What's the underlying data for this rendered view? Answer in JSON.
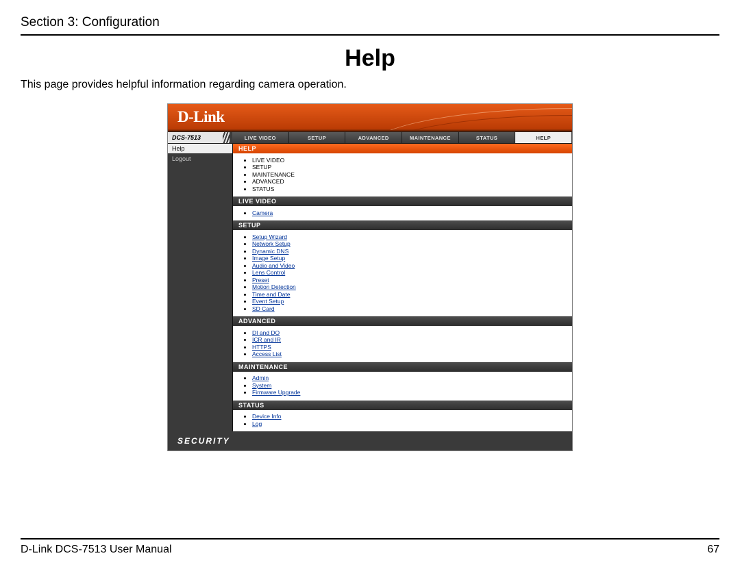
{
  "doc": {
    "section_header": "Section 3: Configuration",
    "page_title": "Help",
    "intro": "This page provides helpful information regarding camera operation.",
    "footer_left": "D-Link DCS-7513 User Manual",
    "footer_right": "67"
  },
  "ui": {
    "brand": "D-Link",
    "model": "DCS-7513",
    "tabs": {
      "live": "LIVE VIDEO",
      "setup": "SETUP",
      "advanced": "ADVANCED",
      "maintenance": "MAINTENANCE",
      "status": "STATUS",
      "help": "HELP"
    },
    "sidebar": {
      "help": "Help",
      "logout": "Logout"
    },
    "sections": {
      "help_bar": "HELP",
      "help_items": {
        "a": "LIVE VIDEO",
        "b": "SETUP",
        "c": "MAINTENANCE",
        "d": "ADVANCED",
        "e": "STATUS"
      },
      "live_bar": "LIVE VIDEO",
      "live_items": {
        "a": "Camera"
      },
      "setup_bar": "SETUP",
      "setup_items": {
        "a": "Setup Wizard",
        "b": "Network Setup",
        "c": "Dynamic DNS",
        "d": "Image Setup",
        "e": "Audio and Video",
        "f": "Lens Control",
        "g": "Preset",
        "h": "Motion Detection",
        "i": "Time and Date",
        "j": "Event Setup",
        "k": "SD Card"
      },
      "advanced_bar": "ADVANCED",
      "advanced_items": {
        "a": "DI and DO",
        "b": "ICR and IR",
        "c": "HTTPS",
        "d": "Access List"
      },
      "maintenance_bar": "MAINTENANCE",
      "maintenance_items": {
        "a": "Admin",
        "b": "System",
        "c": "Firmware Upgrade"
      },
      "status_bar": "STATUS",
      "status_items": {
        "a": "Device Info",
        "b": "Log"
      }
    },
    "bottom_brand": "SECURITY"
  }
}
